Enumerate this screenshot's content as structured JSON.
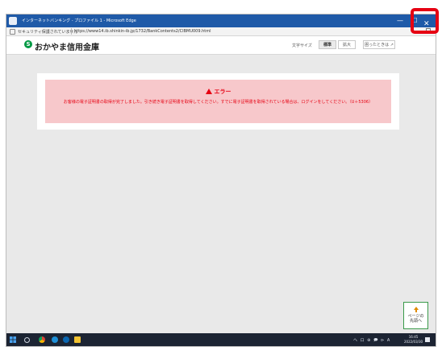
{
  "window": {
    "title": "インターネットバンキング - プロファイル 1 - Microsoft Edge",
    "minimize_glyph": "—",
    "maximize_glyph": "☐",
    "close_glyph": "✕"
  },
  "address_bar": {
    "security_warning": "セキュリティ保護されていません",
    "url": "https://www14.ib.shinkin-ib.jp/1732/BankContents2/CIBMU009.html"
  },
  "site_header": {
    "logo_mark": "S",
    "bank_name": "おかやま信用金庫",
    "font_size_label": "文字サイズ",
    "font_size_standard": "標準",
    "font_size_large": "拡大",
    "help_label": "困ったときは"
  },
  "error": {
    "title": "エラー",
    "message": "お客様の電子証明書の取得が完了しました。引き続き電子証明書を取得してください。すでに電子証明書を取得されている場合は、ログインをしてください。（U＋5306）"
  },
  "page_top": {
    "label": "ページの\n先頭へ"
  },
  "taskbar": {
    "tray_text": "へ ロ ⊕ 🗩 ⊳ A",
    "clock": "16:45\n2022/03/30"
  },
  "colors": {
    "title_bar": "#1f5aa8",
    "error_background": "#f7c8cb",
    "error_text": "#e60012",
    "highlight_box": "#e60012",
    "logo_green": "#009944",
    "page_top_border": "#3a9a4a",
    "page_top_arrow": "#e08a00"
  },
  "icons": {
    "window": "browser-icon",
    "lock": "lock-icon",
    "logo": "okayama-shinkin-logo-icon",
    "error": "warning-triangle-icon",
    "page_top": "arrow-up-icon",
    "start": "windows-start-icon",
    "search": "search-icon"
  }
}
